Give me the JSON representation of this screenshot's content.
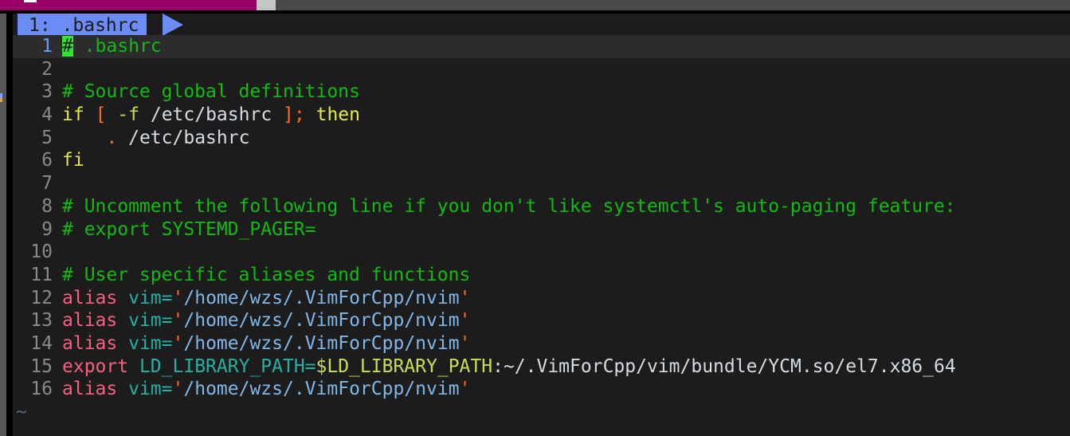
{
  "window": {
    "topbar": {
      "accent_color": "#990066",
      "bar_color": "#4a4a4a",
      "chip_color": "#c6c6c6"
    }
  },
  "tabline": {
    "tabs": [
      {
        "label": "1: .bashrc",
        "active": true
      }
    ]
  },
  "editor": {
    "filename": ".bashrc",
    "cursor_line": 1,
    "cursor_char": "#",
    "background": "#1c1c1c",
    "cursorline_background": "#2c2c2c",
    "empty_marker": "~",
    "lines": [
      {
        "n": "1",
        "text": "# .bashrc"
      },
      {
        "n": "2",
        "text": ""
      },
      {
        "n": "3",
        "text": "# Source global definitions"
      },
      {
        "n": "4",
        "text": "if [ -f /etc/bashrc ]; then"
      },
      {
        "n": "5",
        "text": "    . /etc/bashrc"
      },
      {
        "n": "6",
        "text": "fi"
      },
      {
        "n": "7",
        "text": ""
      },
      {
        "n": "8",
        "text": "# Uncomment the following line if you don't like systemctl's auto-paging feature:"
      },
      {
        "n": "9",
        "text": "# export SYSTEMD_PAGER="
      },
      {
        "n": "10",
        "text": ""
      },
      {
        "n": "11",
        "text": "# User specific aliases and functions"
      },
      {
        "n": "12",
        "text": "alias vim='/home/wzs/.VimForCpp/nvim'"
      },
      {
        "n": "13",
        "text": "alias vim='/home/wzs/.VimForCpp/nvim'"
      },
      {
        "n": "14",
        "text": "alias vim='/home/wzs/.VimForCpp/nvim'"
      },
      {
        "n": "15",
        "text": "export LD_LIBRARY_PATH=$LD_LIBRARY_PATH:~/.VimForCpp/vim/bundle/YCM.so/el7.x86_64"
      },
      {
        "n": "16",
        "text": "alias vim='/home/wzs/.VimForCpp/nvim'"
      }
    ],
    "tokens": {
      "l1": {
        "cursor": "#",
        "rest": " .bashrc"
      },
      "l3": {
        "comment": "# Source global definitions"
      },
      "l4": {
        "kw_if": "if",
        "sp1": " ",
        "br_open": "[",
        "sp2": " ",
        "flag": "-f",
        "sp3": " ",
        "path": "/etc/bashrc",
        "sp4": " ",
        "br_close": "];",
        "sp5": " ",
        "kw_then": "then"
      },
      "l5": {
        "indent": "    ",
        "dot": ".",
        "sp": " ",
        "path": "/etc/bashrc"
      },
      "l6": {
        "kw_fi": "fi"
      },
      "l8": {
        "comment": "# Uncomment the following line if you don't like systemctl's auto-paging feature:"
      },
      "l9": {
        "comment": "# export SYSTEMD_PAGER="
      },
      "l11": {
        "comment": "# User specific aliases and functions"
      },
      "alias_line": {
        "kw": "alias",
        "sp": " ",
        "name": "vim",
        "eq": "=",
        "q1": "'",
        "str": "/home/wzs/.VimForCpp/nvim",
        "q2": "'"
      },
      "l15": {
        "kw": "export",
        "sp": " ",
        "name": "LD_LIBRARY_PATH",
        "eq": "=",
        "var": "$LD_LIBRARY_PATH",
        "rest": ":~/.VimForCpp/vim/bundle/YCM.so/el7.x86_64"
      }
    }
  },
  "colors": {
    "comment": "#11bb11",
    "keyword": "#e7e74b",
    "bracket": "#ff6a1f",
    "flag": "#c5e04f",
    "path": "#d6dce3",
    "builtin": "#fb5f80",
    "identifier": "#23b0a5",
    "quote": "#ff6a1f",
    "string": "#7fb8e8",
    "variable": "#c5e04f",
    "cursor": "#2ee62e",
    "linenr": "#8a8a8a",
    "linenr_current": "#6b9bf5",
    "tab_active": "#6b8bf5",
    "tilde": "#5b6a82"
  }
}
